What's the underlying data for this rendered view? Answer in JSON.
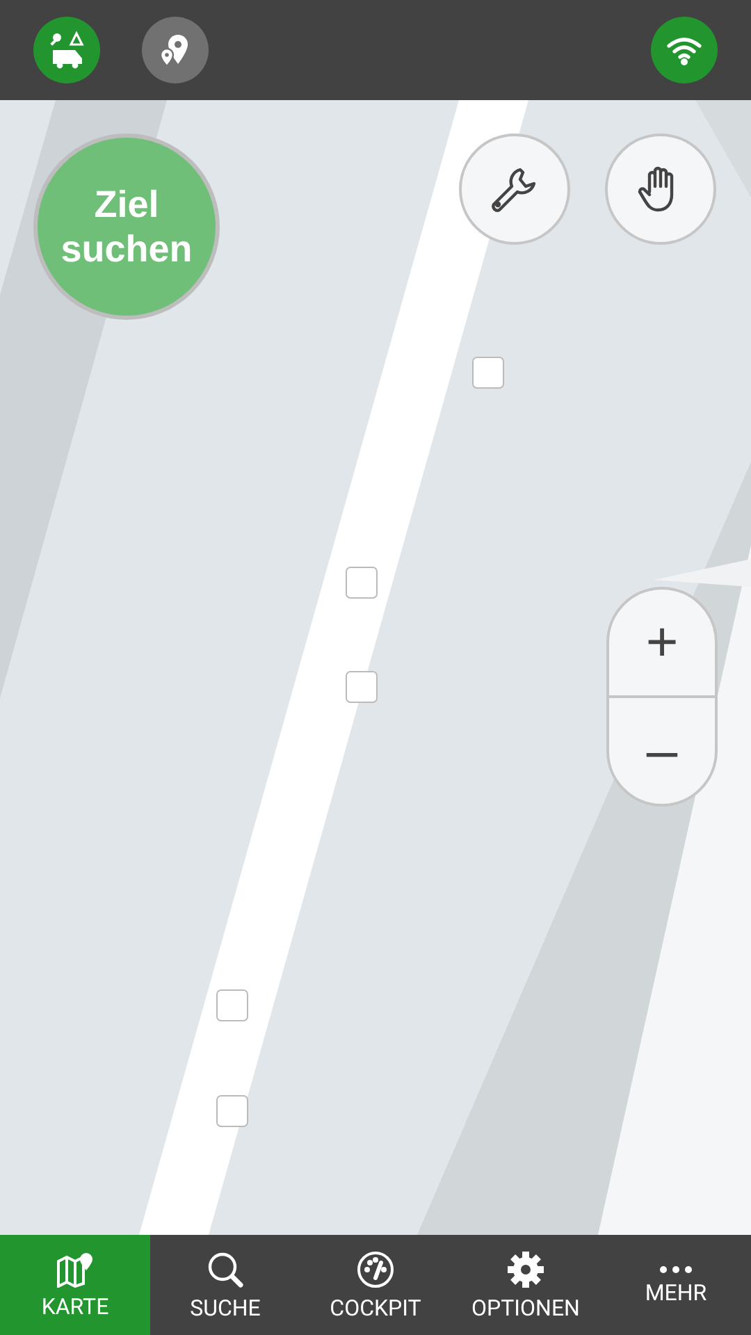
{
  "top_bar": {
    "buttons": [
      {
        "kind": "camper",
        "active": true
      },
      {
        "kind": "places",
        "active": false
      },
      {
        "kind": "wifi",
        "active": true
      }
    ]
  },
  "search_button": {
    "label": "Ziel suchen"
  },
  "zoom": {
    "in": "+",
    "out": "–"
  },
  "tabs": [
    {
      "kind": "map",
      "label": "KARTE",
      "selected": true
    },
    {
      "kind": "search",
      "label": "SUCHE",
      "selected": false
    },
    {
      "kind": "gauge",
      "label": "COCKPIT",
      "selected": false
    },
    {
      "kind": "gear",
      "label": "OPTIONEN",
      "selected": false
    },
    {
      "kind": "more",
      "label": "MEHR",
      "selected": false
    }
  ]
}
